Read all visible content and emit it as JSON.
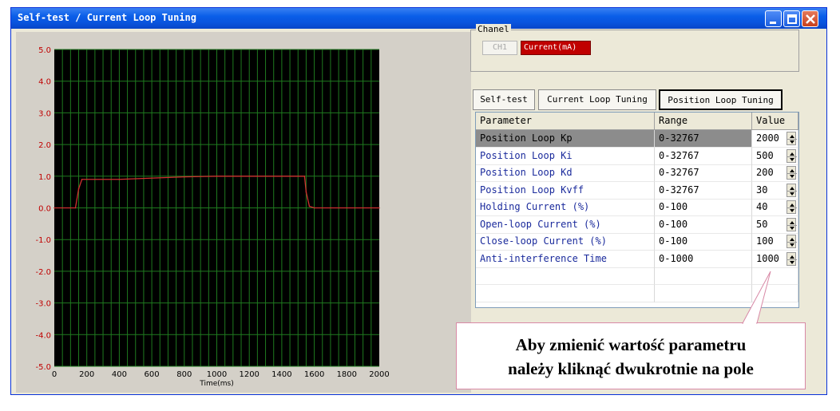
{
  "window": {
    "title": "Self-test / Current Loop Tuning"
  },
  "chart_data": {
    "type": "line",
    "title": "",
    "xlabel": "Time(ms)",
    "ylabel": "",
    "xlim": [
      0,
      2000
    ],
    "ylim": [
      -5.0,
      5.0
    ],
    "grid": true,
    "x_ticks": [
      0,
      200,
      400,
      600,
      800,
      1000,
      1200,
      1400,
      1600,
      1800,
      2000
    ],
    "y_ticks": [
      5.0,
      4.0,
      3.0,
      2.0,
      1.0,
      0.0,
      -1.0,
      -2.0,
      -3.0,
      -4.0,
      -5.0
    ],
    "colors": {
      "background": "#000000",
      "grid": "#1f7a1f",
      "setpoint": "#c8c8c8",
      "actual": "#d03030",
      "ytick_text": "#c00000"
    },
    "series": [
      {
        "x": [
          0,
          130,
          150,
          170,
          400,
          800,
          1000,
          1540,
          1550,
          1570,
          1600,
          2000
        ],
        "y": [
          0.0,
          0.0,
          0.6,
          0.9,
          0.9,
          0.98,
          1.0,
          1.0,
          0.5,
          0.05,
          0.0,
          0.0
        ]
      }
    ]
  },
  "chanel": {
    "label": "Chanel",
    "ch1_label": "CH1",
    "current_label": "Current(mA)"
  },
  "tabs": [
    {
      "label": "Self-test"
    },
    {
      "label": "Current Loop Tuning"
    },
    {
      "label": "Position Loop Tuning",
      "active": true
    }
  ],
  "table": {
    "headers": [
      "Parameter",
      "Range",
      "Value"
    ],
    "rows": [
      {
        "name": "Position Loop Kp",
        "range": "0-32767",
        "value": "2000",
        "selected": true
      },
      {
        "name": "Position Loop Ki",
        "range": "0-32767",
        "value": "500"
      },
      {
        "name": "Position Loop Kd",
        "range": "0-32767",
        "value": "200"
      },
      {
        "name": "Position Loop Kvff",
        "range": "0-32767",
        "value": "30"
      },
      {
        "name": "Holding Current (%)",
        "range": "0-100",
        "value": "40"
      },
      {
        "name": "Open-loop Current (%)",
        "range": "0-100",
        "value": "50"
      },
      {
        "name": "Close-loop Current (%)",
        "range": "0-100",
        "value": "100"
      },
      {
        "name": "Anti-interference Time",
        "range": "0-1000",
        "value": "1000"
      }
    ]
  },
  "callout": {
    "line1": "Aby zmienić wartość parametru",
    "line2": "należy kliknąć dwukrotnie na pole"
  }
}
